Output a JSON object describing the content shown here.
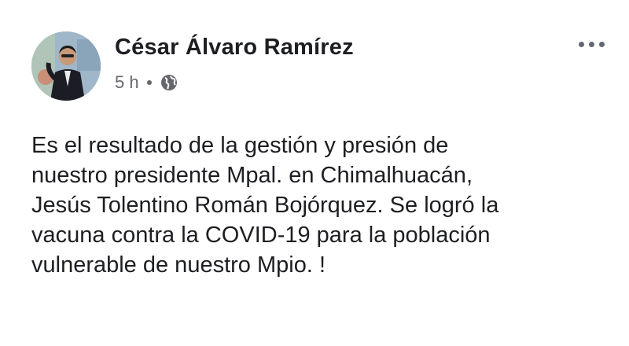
{
  "post": {
    "author_name": "César Álvaro Ramírez",
    "time": "5 h",
    "privacy_icon": "globe-icon",
    "more_icon": "more-options-icon",
    "text_lines": [
      "Es el resultado de la gestión y presión de",
      "nuestro presidente Mpal. en Chimalhuacán,",
      "Jesús Tolentino Román Bojórquez. Se logró la",
      "vacuna contra la COVID-19 para la población",
      "vulnerable de nuestro Mpio. !"
    ]
  },
  "colors": {
    "primary_text": "#1c1e21",
    "secondary_text": "#65676b",
    "background": "#ffffff"
  }
}
